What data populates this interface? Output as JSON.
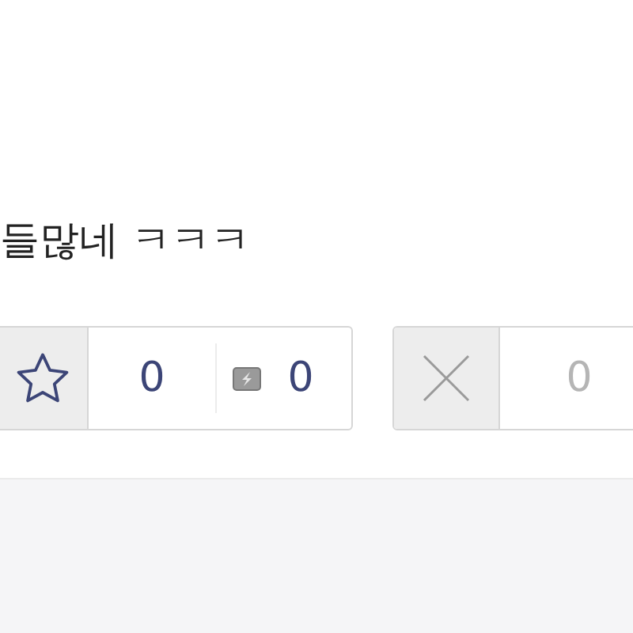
{
  "post_text": "들많네 ㅋㅋㅋ",
  "recommend": {
    "count": "0",
    "sub_count": "0"
  },
  "decline": {
    "count": "0"
  }
}
